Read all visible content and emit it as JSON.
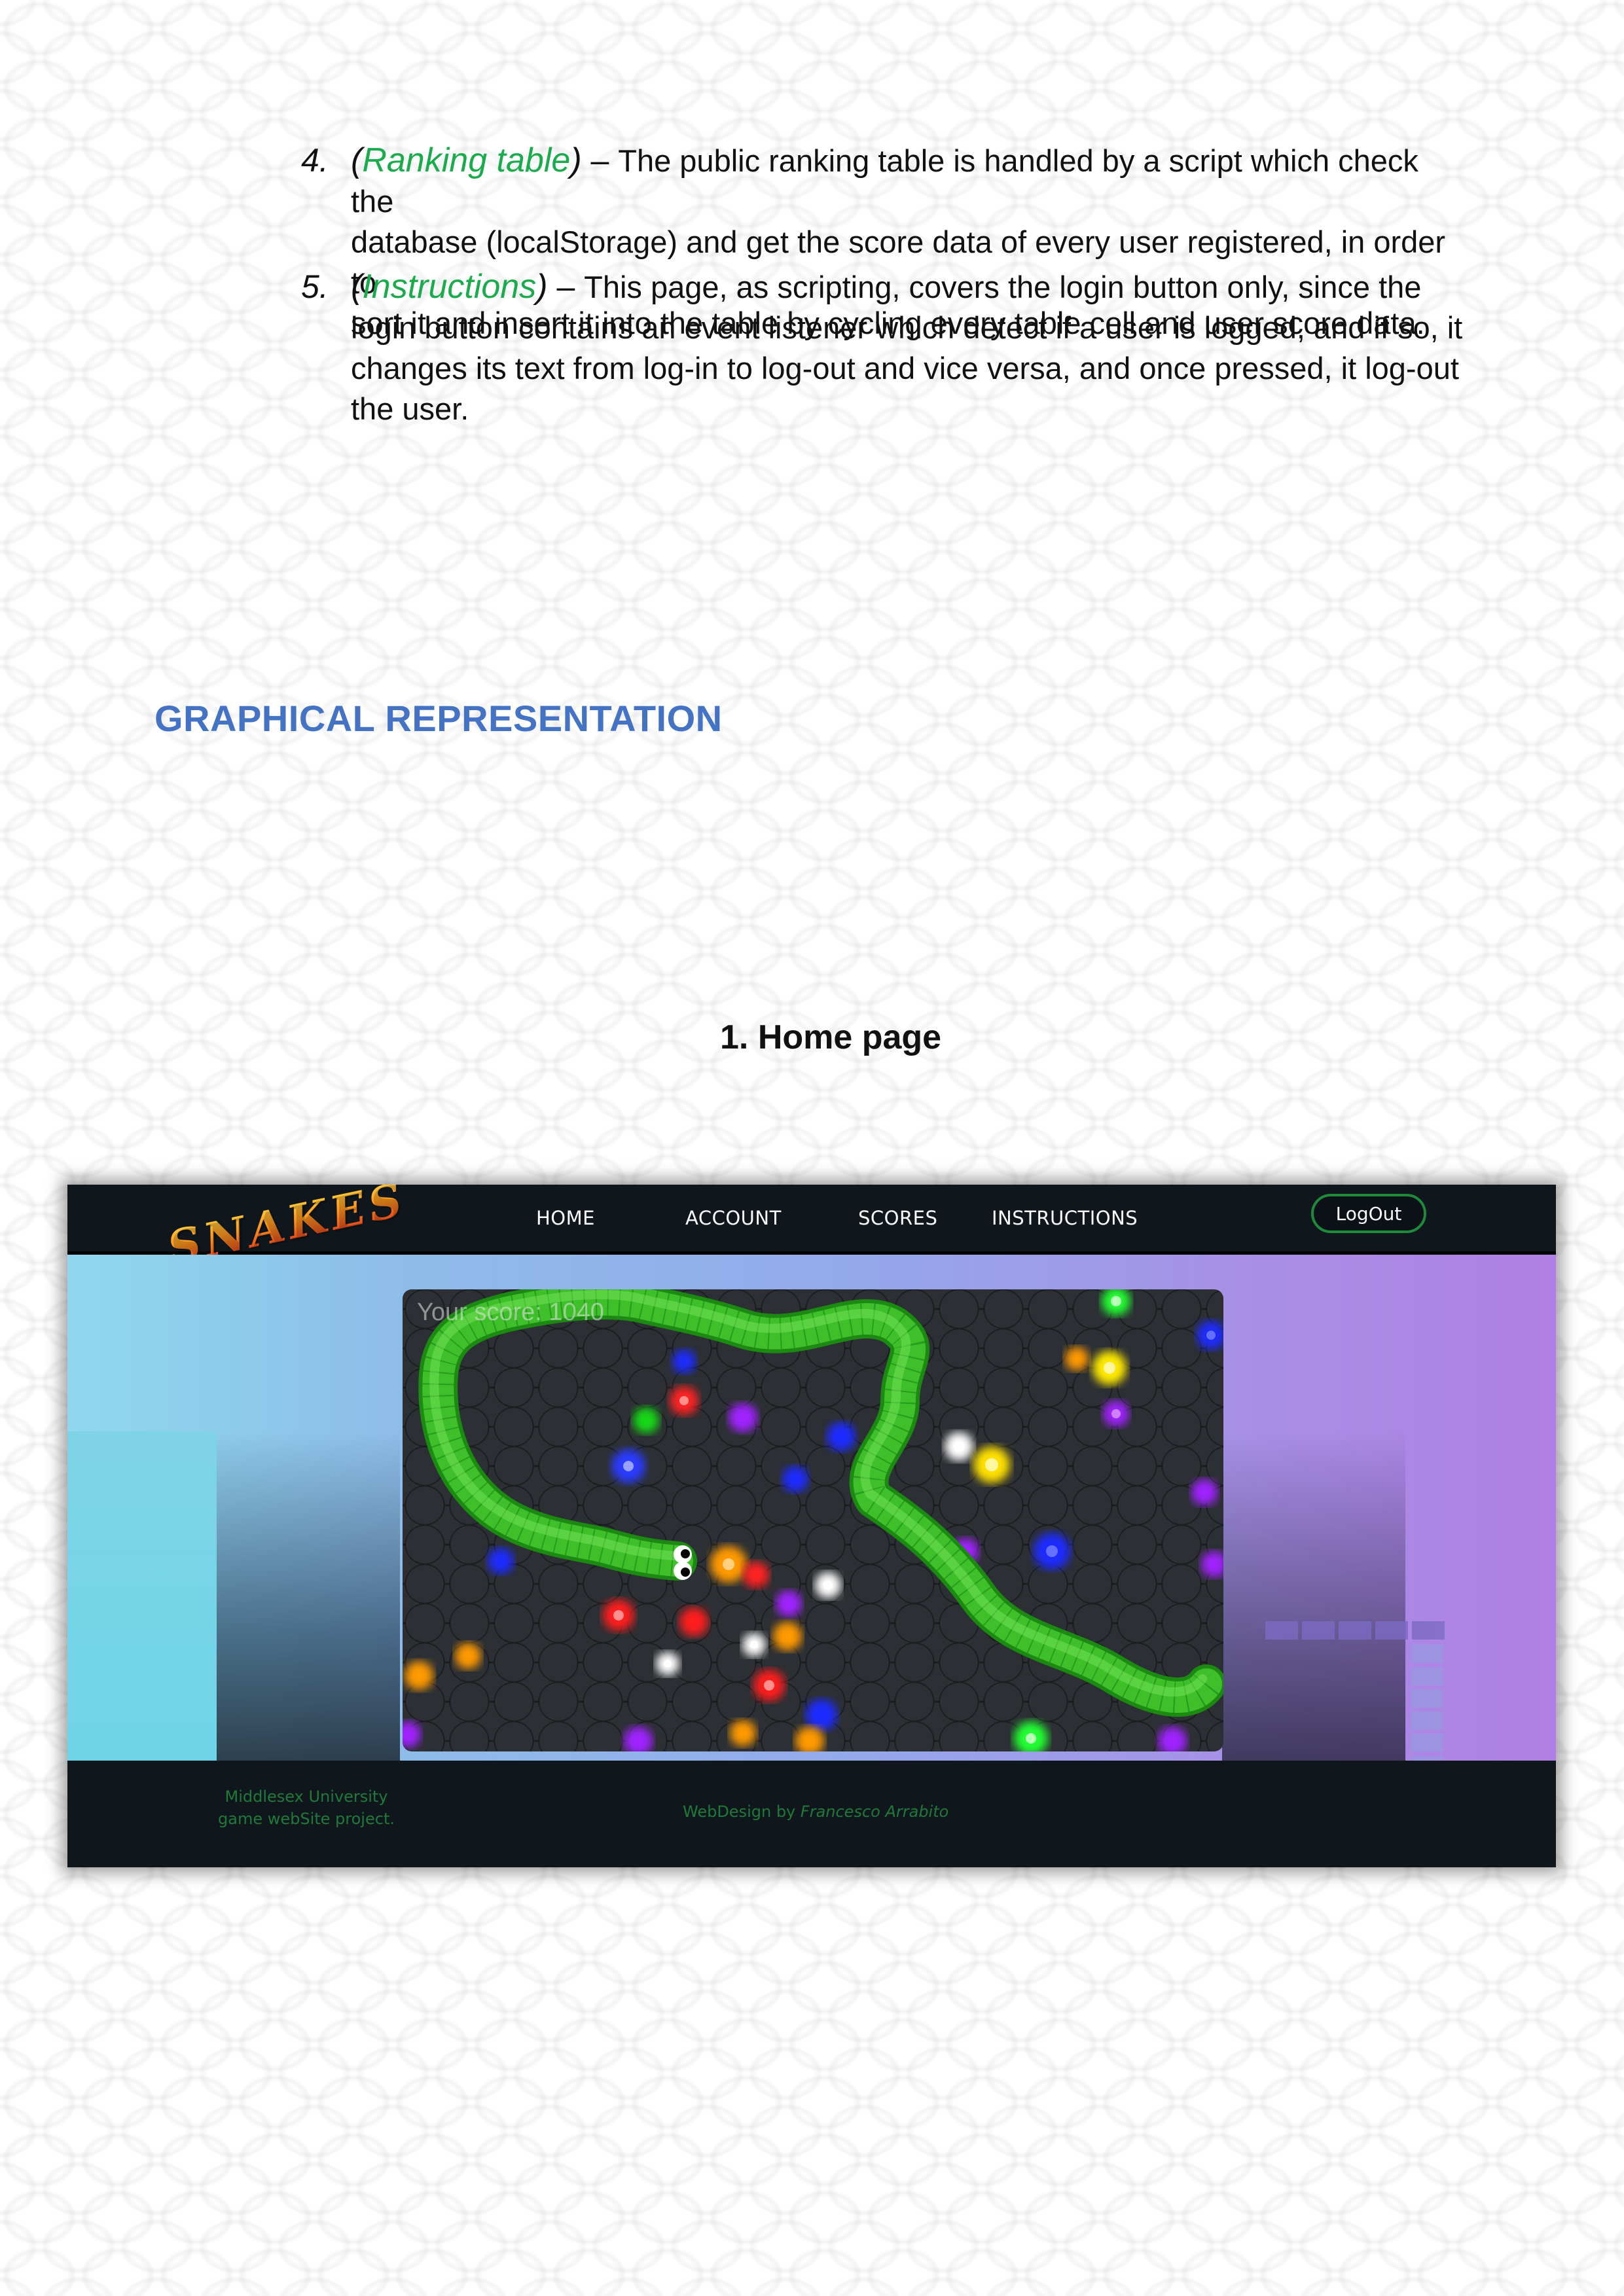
{
  "items": [
    {
      "number": "4.",
      "open_paren": "(",
      "keyword": "Ranking table",
      "close_paren": ")",
      "dash": " – ",
      "lines": [
        "The public ranking table is handled by a script which check the",
        "database (localStorage) and get the score data of every user registered, in order to",
        "sort it and insert it into the table by cycling every table cell and user score data."
      ]
    },
    {
      "number": "5.",
      "open_paren": "(",
      "keyword": "Instructions",
      "close_paren": ")",
      "dash": " – ",
      "lines": [
        "This page, as scripting, covers the login button only, since the",
        "login button contains an event listener which detect if a user is logged, and if so, it",
        "changes its text from log-in to log-out and vice versa, and once pressed, it log-out",
        "the user."
      ]
    }
  ],
  "section_heading": "GRAPHICAL REPRESENTATION",
  "figure_caption": "1.  Home page",
  "screenshot": {
    "logo": "SNAKES",
    "nav": [
      "HOME",
      "ACCOUNT",
      "SCORES",
      "INSTRUCTIONS"
    ],
    "logout_label": "LogOut",
    "score_text": "Your score: 1040",
    "footer_left": [
      "Middlesex University",
      "game webSite project."
    ],
    "footer_credit_prefix": "WebDesign by ",
    "footer_credit_name": "Francesco Arrabito",
    "colors": {
      "snake": "#3fbf2a",
      "heading": "#4472c4",
      "keyword": "#1aab4c",
      "footer_text": "#1f7a3a"
    }
  }
}
